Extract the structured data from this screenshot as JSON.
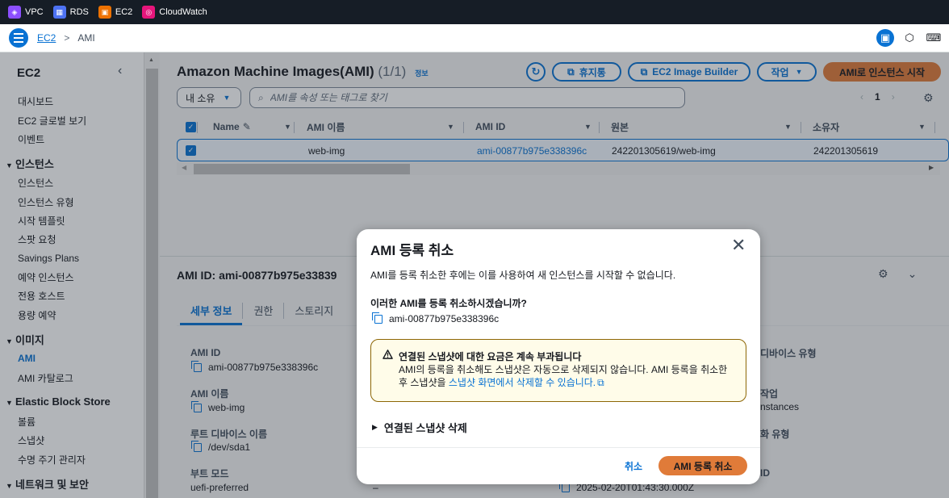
{
  "topbar": {
    "services": [
      {
        "label": "VPC",
        "icon": "vpc-icon",
        "color": "#8c4fff"
      },
      {
        "label": "RDS",
        "icon": "rds-icon",
        "color": "#4d72f3"
      },
      {
        "label": "EC2",
        "icon": "ec2-icon",
        "color": "#ed7100"
      },
      {
        "label": "CloudWatch",
        "icon": "cloudwatch-icon",
        "color": "#e7157b"
      }
    ]
  },
  "breadcrumb": {
    "root": "EC2",
    "current": "AMI"
  },
  "sidebar": {
    "title": "EC2",
    "items_top": [
      "대시보드",
      "EC2 글로벌 보기",
      "이벤트"
    ],
    "instances": {
      "title": "인스턴스",
      "items": [
        "인스턴스",
        "인스턴스 유형",
        "시작 템플릿",
        "스팟 요청",
        "Savings Plans",
        "예약 인스턴스",
        "전용 호스트",
        "용량 예약"
      ]
    },
    "images": {
      "title": "이미지",
      "items": [
        "AMI",
        "AMI 카탈로그"
      ]
    },
    "ebs": {
      "title": "Elastic Block Store",
      "items": [
        "볼륨",
        "스냅샷",
        "수명 주기 관리자"
      ]
    },
    "network": {
      "title": "네트워크 및 보안"
    }
  },
  "main": {
    "title": "Amazon Machine Images(AMI)",
    "count": "(1/1)",
    "info": "정보",
    "buttons": {
      "recycle": "휴지통",
      "builder": "EC2 Image Builder",
      "actions": "작업",
      "launch": "AMI로 인스턴스 시작"
    },
    "owner_filter": "내 소유",
    "search_placeholder": "AMI를 속성 또는 태그로 찾기",
    "page": "1",
    "columns": [
      "Name",
      "AMI 이름",
      "AMI ID",
      "원본",
      "소유자"
    ],
    "row": {
      "name": "",
      "ami_name": "web-img",
      "ami_id": "ami-00877b975e338396c",
      "source": "242201305619/web-img",
      "owner": "242201305619"
    },
    "detail_title": "AMI ID: ami-00877b975e33839",
    "tabs": [
      "세부 정보",
      "권한",
      "스토리지"
    ],
    "details": {
      "ami_id_label": "AMI ID",
      "ami_id_value": "ami-00877b975e338396c",
      "ami_name_label": "AMI 이름",
      "ami_name_value": "web-img",
      "root_label": "루트 디바이스 이름",
      "root_value": "/dev/sda1",
      "boot_label": "부트 모드",
      "boot_value": "uefi-preferred",
      "dash1": "–",
      "date_partial": "2025-02-20T01:43:30.000Z",
      "right1": "디바이스 유형",
      "right2": "작업",
      "right2_val": "nstances",
      "right3": "화 유형",
      "right4": "ID"
    }
  },
  "modal": {
    "title": "AMI 등록 취소",
    "description": "AMI를 등록 취소한 후에는 이를 사용하여 새 인스턴스를 시작할 수 없습니다.",
    "question": "이러한 AMI를 등록 취소하시겠습니까?",
    "ami_id": "ami-00877b975e338396c",
    "alert_title": "연결된 스냅샷에 대한 요금은 계속 부과됩니다",
    "alert_body": "AMI의 등록을 취소해도 스냅샷은 자동으로 삭제되지 않습니다. AMI 등록을 취소한 후 스냅샷을 ",
    "alert_link": "스냅샷 화면에서 삭제할 수 있습니다.",
    "expand": "연결된 스냅샷 삭제",
    "cancel": "취소",
    "confirm": "AMI 등록 취소"
  }
}
